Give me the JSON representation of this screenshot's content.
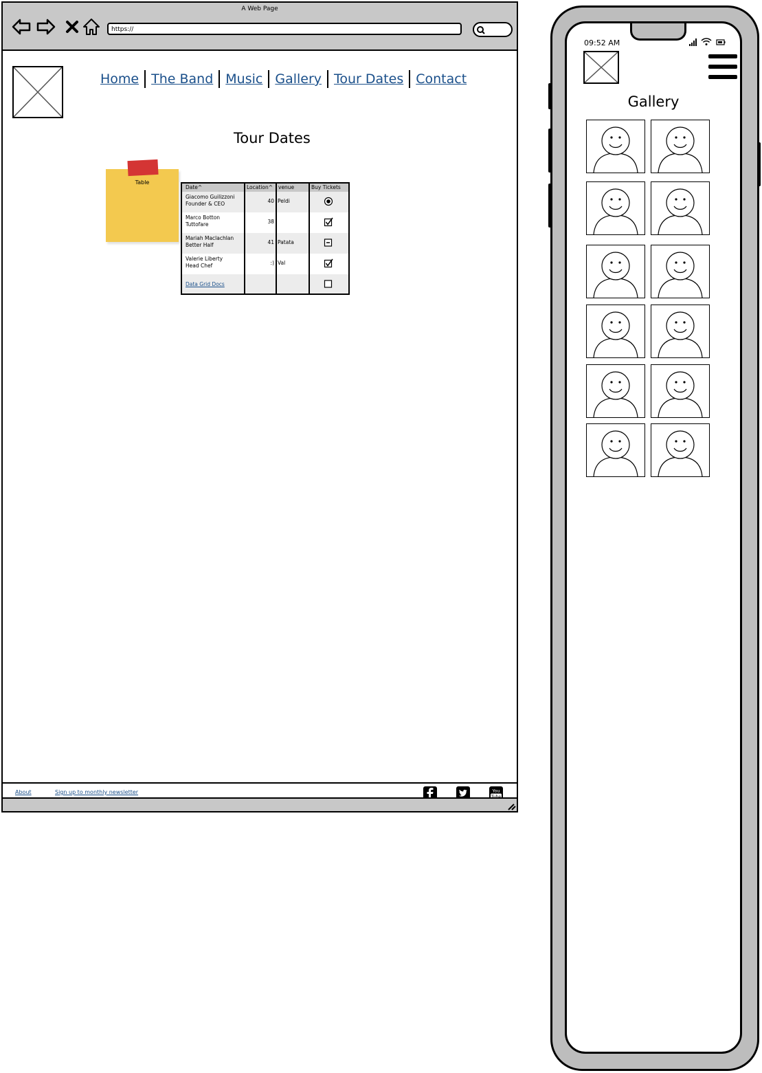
{
  "browser": {
    "title": "A Web Page",
    "url": "https://"
  },
  "nav": {
    "items": [
      {
        "label": "Home"
      },
      {
        "label": "The Band"
      },
      {
        "label": "Music"
      },
      {
        "label": "Gallery"
      },
      {
        "label": "Tour Dates"
      },
      {
        "label": "Contact"
      }
    ]
  },
  "page": {
    "title": "Tour Dates"
  },
  "sticky": {
    "label": "Table"
  },
  "grid": {
    "headers": [
      "Date^",
      "Location^",
      "venue",
      "Buy Tickets"
    ],
    "rows": [
      {
        "name1": "Giacomo Guilizzoni",
        "name2": "Founder & CEO",
        "value": "40",
        "venue": "Peldi",
        "control": "radio-checked"
      },
      {
        "name1": "Marco Botton",
        "name2": "Tuttofare",
        "value": "38",
        "venue": "",
        "control": "checkbox-checked"
      },
      {
        "name1": "Mariah Maclachlan",
        "name2": "Better Half",
        "value": "41",
        "venue": "Patata",
        "control": "checkbox-indeterminate"
      },
      {
        "name1": "Valerie Liberty",
        "name2": "Head Chef",
        "value": ":)",
        "venue": "Val",
        "control": "checkbox-checked"
      }
    ],
    "docs_link": "Data Grid Docs",
    "last_control": "checkbox-unchecked"
  },
  "footer": {
    "about": "About",
    "newsletter": "Sign up to monthly newsletter",
    "social": [
      "facebook-icon",
      "twitter-icon",
      "youtube-icon"
    ],
    "youtube_text_1": "You",
    "youtube_text_2": "Tube"
  },
  "phone": {
    "time": "09:52 AM",
    "gallery_title": "Gallery",
    "gallery_count": 12
  }
}
